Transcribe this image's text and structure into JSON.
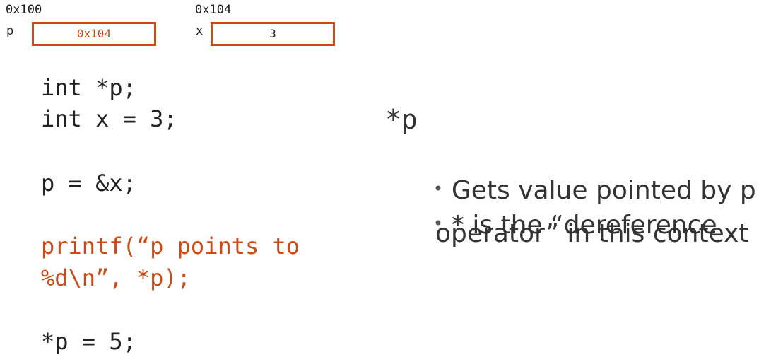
{
  "memory": {
    "p": {
      "address": "0x100",
      "name": "p",
      "value": "0x104"
    },
    "x": {
      "address": "0x104",
      "name": "x",
      "value": "3"
    }
  },
  "code_lines": [
    "int *p;",
    "int x = 3;",
    "p = &x;",
    "printf(“p points to",
    "%d\\n”, *p);",
    "*p = 5;"
  ],
  "explanation": {
    "heading": "*p",
    "bullets": [
      "Gets value pointed by p",
      "* is the “dereference",
      "operator” in this context"
    ]
  },
  "colors": {
    "accent": "#cc4a16",
    "text": "#2a2a2a"
  }
}
